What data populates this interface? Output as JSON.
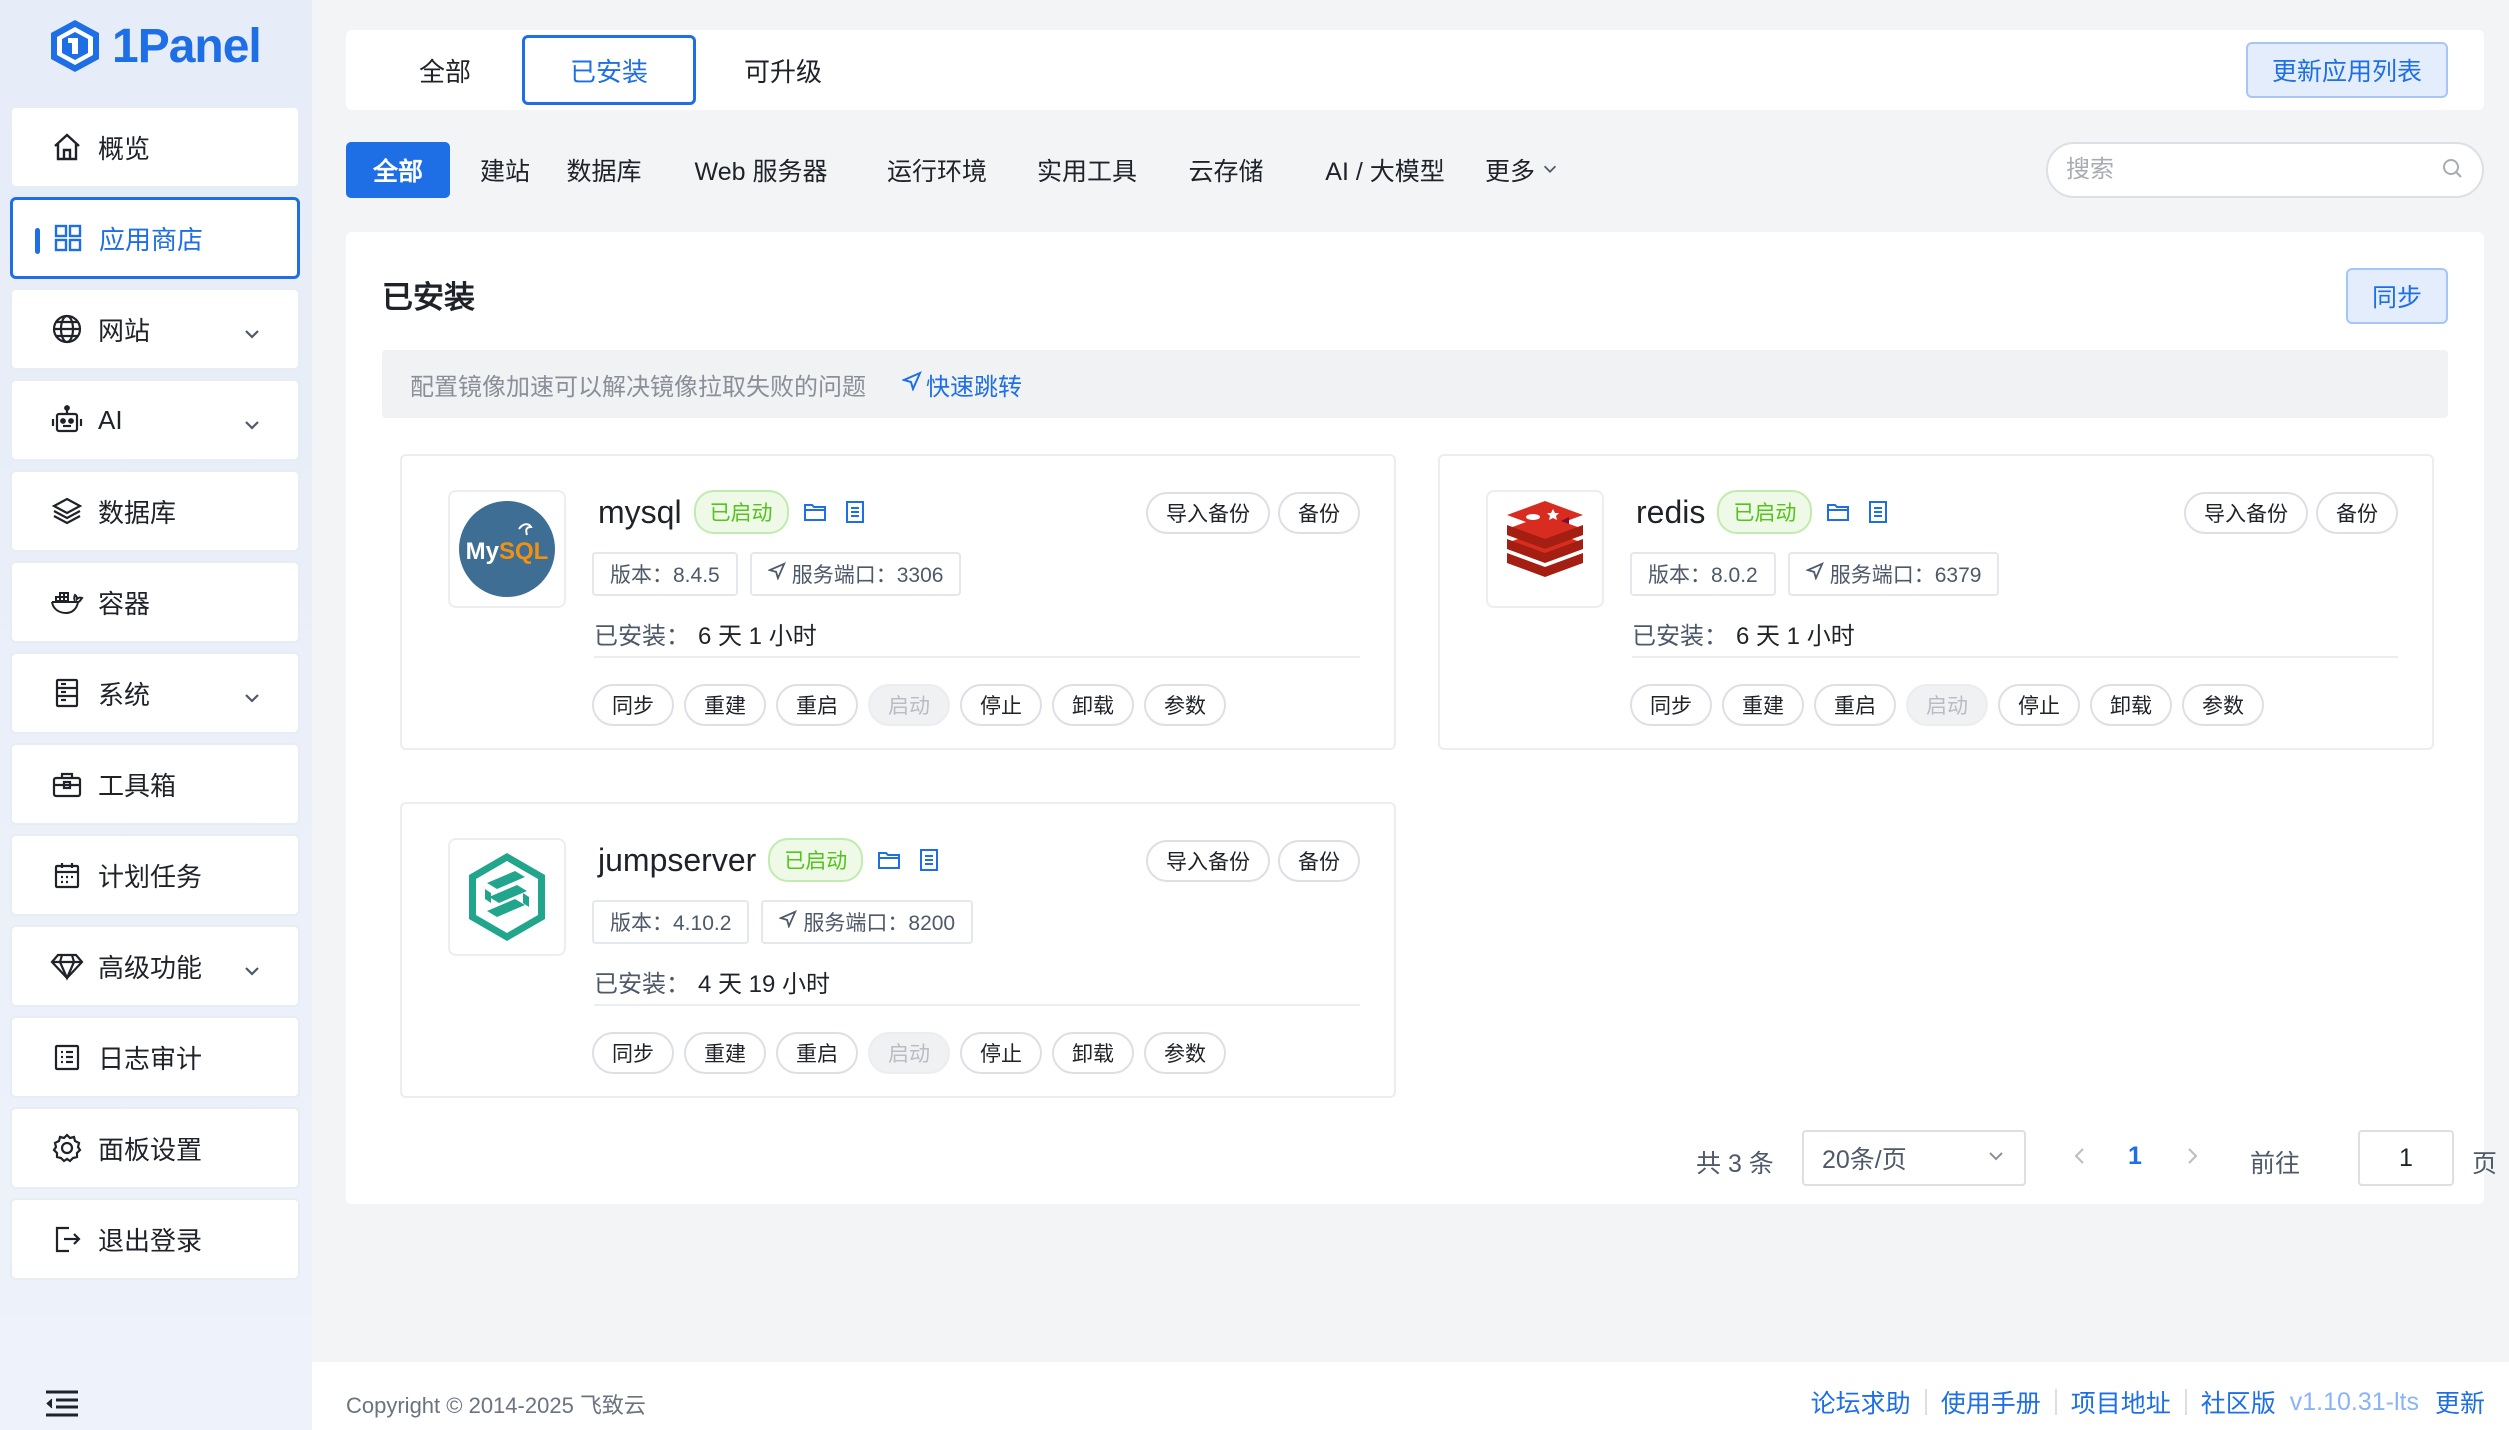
{
  "app": {
    "logo_text": "1Panel"
  },
  "sidebar": {
    "items": [
      {
        "label": "概览",
        "icon": "home-icon",
        "chevron": false,
        "active": false
      },
      {
        "label": "应用商店",
        "icon": "grid-icon",
        "chevron": false,
        "active": true
      },
      {
        "label": "网站",
        "icon": "globe-icon",
        "chevron": true,
        "active": false
      },
      {
        "label": "AI",
        "icon": "robot-icon",
        "chevron": true,
        "active": false
      },
      {
        "label": "数据库",
        "icon": "layers-icon",
        "chevron": false,
        "active": false
      },
      {
        "label": "容器",
        "icon": "docker-icon",
        "chevron": false,
        "active": false
      },
      {
        "label": "系统",
        "icon": "server-icon",
        "chevron": true,
        "active": false
      },
      {
        "label": "工具箱",
        "icon": "toolbox-icon",
        "chevron": false,
        "active": false
      },
      {
        "label": "计划任务",
        "icon": "calendar-icon",
        "chevron": false,
        "active": false
      },
      {
        "label": "高级功能",
        "icon": "diamond-icon",
        "chevron": true,
        "active": false
      },
      {
        "label": "日志审计",
        "icon": "log-icon",
        "chevron": false,
        "active": false
      },
      {
        "label": "面板设置",
        "icon": "gear-icon",
        "chevron": false,
        "active": false
      },
      {
        "label": "退出登录",
        "icon": "logout-icon",
        "chevron": false,
        "active": false
      }
    ]
  },
  "topbar": {
    "tabs": [
      {
        "label": "全部",
        "active": false
      },
      {
        "label": "已安装",
        "active": true
      },
      {
        "label": "可升级",
        "active": false
      }
    ],
    "refresh_label": "更新应用列表"
  },
  "categories": {
    "items": [
      "全部",
      "建站",
      "数据库",
      "Web 服务器",
      "运行环境",
      "实用工具",
      "云存储",
      "AI / 大模型",
      "更多"
    ],
    "active": "全部",
    "search_placeholder": "搜索"
  },
  "panel": {
    "title": "已安装",
    "sync_label": "同步",
    "notice": "配置镜像加速可以解决镜像拉取失败的问题",
    "notice_link": "快速跳转"
  },
  "apps": [
    {
      "name": "mysql",
      "status": "已启动",
      "version": "版本：8.4.5",
      "port": "服务端口：3306",
      "installed_label": "已安装：",
      "installed_time": "6 天 1 小时",
      "logo": "mysql-logo"
    },
    {
      "name": "redis",
      "status": "已启动",
      "version": "版本：8.0.2",
      "port": "服务端口：6379",
      "installed_label": "已安装：",
      "installed_time": "6 天 1 小时",
      "logo": "redis-logo"
    },
    {
      "name": "jumpserver",
      "status": "已启动",
      "version": "版本：4.10.2",
      "port": "服务端口：8200",
      "installed_label": "已安装：",
      "installed_time": "4 天 19 小时",
      "logo": "jumpserver-logo"
    }
  ],
  "card_buttons": {
    "import_backup": "导入备份",
    "backup": "备份",
    "actions": [
      "同步",
      "重建",
      "重启",
      "启动",
      "停止",
      "卸载",
      "参数"
    ]
  },
  "mysql_logo_text": "MySQL",
  "pagination": {
    "total": "共 3 条",
    "page_size": "20条/页",
    "current_page": "1",
    "goto_label": "前往",
    "goto_value": "1",
    "page_unit": "页"
  },
  "footer": {
    "copyright": "Copyright © 2014-2025 飞致云",
    "links": [
      "论坛求助",
      "使用手册",
      "项目地址",
      "社区版"
    ],
    "version": "v1.10.31-lts",
    "update": "更新"
  },
  "colors": {
    "primary": "#1e6fe5",
    "success": "#52c41a",
    "background": "#f3f4f6"
  }
}
